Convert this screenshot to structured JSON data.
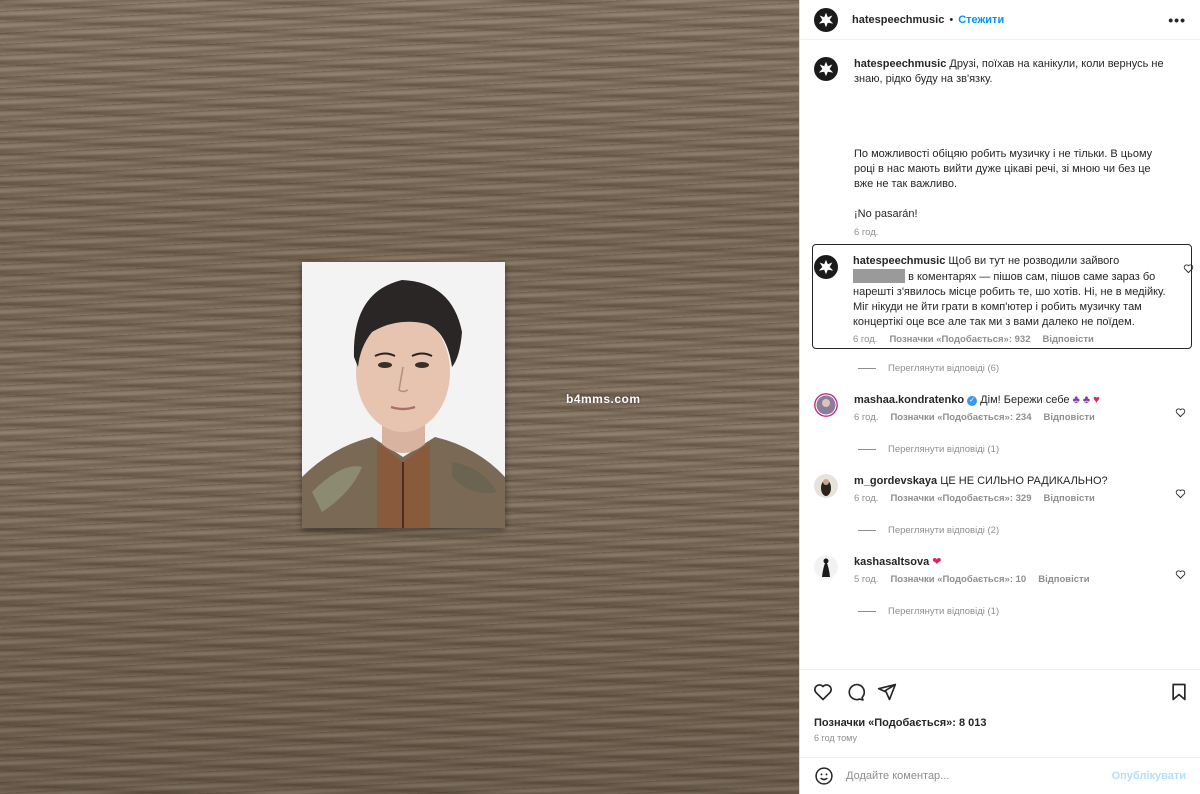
{
  "media": {
    "watermark": "b4mms.com"
  },
  "header": {
    "username": "hatespeechmusic",
    "dot": "•",
    "follow_label": "Стежити",
    "more_label": "•••"
  },
  "caption": {
    "username": "hatespeechmusic",
    "para1": "Друзі, поїхав на канікули, коли вернусь не знаю, рідко буду на зв'язку.",
    "para2": "По можливості обіцяю робить музичку і не тільки. В цьому році в нас мають вийти дуже цікаві речі, зі мною чи без це вже не так важливо.",
    "para3": "¡No pasarán!",
    "time": "6 год."
  },
  "comments": [
    {
      "username": "hatespeechmusic",
      "text_before": "Щоб ви тут не розводили зайвого",
      "text_after": "в коментарях — пішов сам, пішов саме зараз бо нарешті з'явилось місце робить те, шо хотів. Ні, не в медійку. Міг нікуди не йти грати в комп'ютер і робить музичку там концертікі оце все але так ми з вами далеко не поїдем.",
      "time": "6 год.",
      "likes": "Позначки «Подобається»: 932",
      "reply": "Відповісти",
      "view_replies": "Переглянути відповіді (6)"
    },
    {
      "username": "mashaa.kondratenko",
      "verified_mark": "✓",
      "text": "Дім! Бережи себе",
      "emoji": "♣ ♣",
      "heart": "♥",
      "time": "6 год.",
      "likes": "Позначки «Подобається»: 234",
      "reply": "Відповісти",
      "view_replies": "Переглянути відповіді (1)"
    },
    {
      "username": "m_gordevskaya",
      "text": "ЦЕ НЕ СИЛЬНО РАДИКАЛЬНО?",
      "time": "6 год.",
      "likes": "Позначки «Подобається»: 329",
      "reply": "Відповісти",
      "view_replies": "Переглянути відповіді (2)"
    },
    {
      "username": "kashasaltsova",
      "emoji": "❤",
      "time": "5 год.",
      "likes": "Позначки «Подобається»: 10",
      "reply": "Відповісти",
      "view_replies": "Переглянути відповіді (1)"
    }
  ],
  "footer": {
    "likes": "Позначки «Подобається»: 8 013",
    "time_ago": "6 год тому",
    "comment_placeholder": "Додайте коментар...",
    "publish_label": "Опублікувати"
  },
  "colors": {
    "accent": "#0095f6",
    "publish_disabled": "#b2dffc",
    "meta_gray": "#8e8e8e"
  }
}
